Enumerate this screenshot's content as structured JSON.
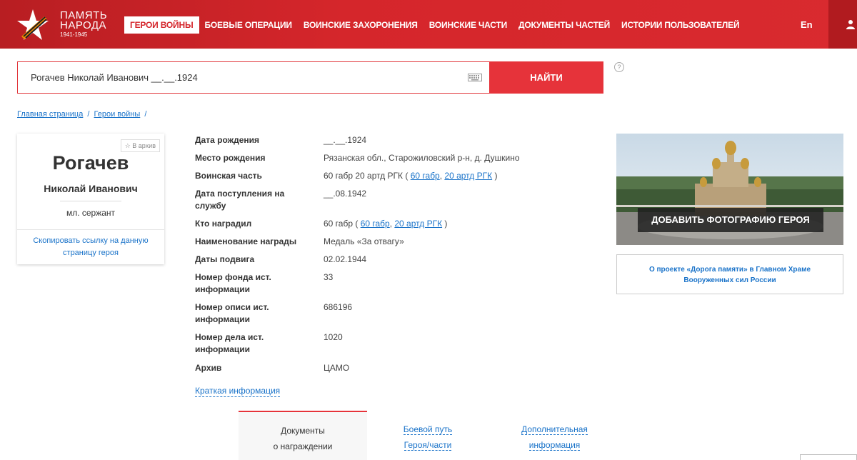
{
  "logo": {
    "line1": "ПАМЯТЬ",
    "line2": "НАРОДА",
    "years": "1941-1945"
  },
  "nav": {
    "items": [
      "ГЕРОИ ВОЙНЫ",
      "БОЕВЫЕ ОПЕРАЦИИ",
      "ВОИНСКИЕ ЗАХОРОНЕНИЯ",
      "ВОИНСКИЕ ЧАСТИ",
      "ДОКУМЕНТЫ ЧАСТЕЙ",
      "ИСТОРИИ ПОЛЬЗОВАТЕЛЕЙ"
    ],
    "lang": "En"
  },
  "search": {
    "value": "Рогачев Николай Иванович __.__.1924",
    "button": "НАЙТИ",
    "help": "?"
  },
  "breadcrumb": {
    "home": "Главная страница",
    "section": "Герои войны",
    "sep": "/"
  },
  "hero": {
    "archive_btn": "☆ В архив",
    "surname": "Рогачев",
    "name": "Николай Иванович",
    "rank": "мл. сержант",
    "copy_link": "Скопировать ссылку на данную страницу героя"
  },
  "info": [
    {
      "key": "Дата рождения",
      "value": "__.__.1924"
    },
    {
      "key": "Место рождения",
      "value": "Рязанская обл., Старожиловский р-н, д. Душкино"
    },
    {
      "key": "Воинская часть",
      "prefix": "60 габр 20 артд РГК ( ",
      "links": [
        "60 габр",
        "20 артд РГК"
      ],
      "suffix": " )"
    },
    {
      "key": "Дата поступления на службу",
      "value": "__.08.1942"
    },
    {
      "key": "Кто наградил",
      "prefix": "60 габр ( ",
      "links": [
        "60 габр",
        "20 артд РГК"
      ],
      "suffix": " )"
    },
    {
      "key": "Наименование награды",
      "value": "Медаль «За отвагу»"
    },
    {
      "key": "Даты подвига",
      "value": "02.02.1944"
    },
    {
      "key": "Номер фонда ист. информации",
      "value": "33"
    },
    {
      "key": "Номер описи ист. информации",
      "value": "686196"
    },
    {
      "key": "Номер дела ист. информации",
      "value": "1020"
    },
    {
      "key": "Архив",
      "value": "ЦАМО"
    }
  ],
  "short_info": "Краткая информация",
  "tabs": {
    "docs": [
      "Документы",
      "о награждении"
    ],
    "path": [
      "Боевой путь",
      "Героя/части"
    ],
    "extra": [
      "Дополнительная",
      "информация"
    ]
  },
  "side": {
    "add_photo": "ДОБАВИТЬ ФОТОГРАФИЮ ГЕРОЯ",
    "project": "О проекте «Дорога памяти» в Главном Храме Вооруженных сил России"
  },
  "colors": {
    "brand_red": "#d5262b",
    "link_blue": "#1a73c9"
  }
}
